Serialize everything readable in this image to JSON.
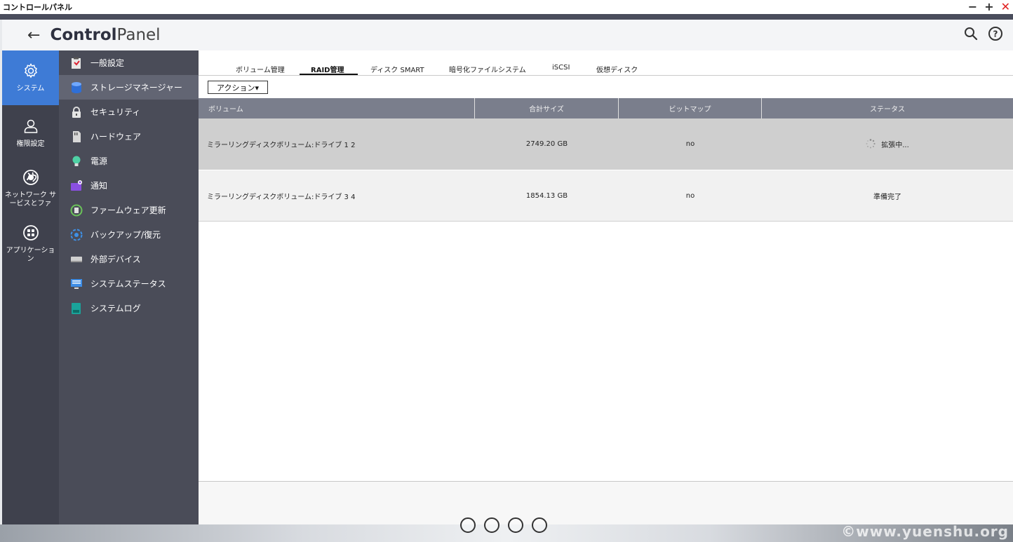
{
  "window": {
    "title": "コントロールパネル",
    "minimize": "−",
    "maximize": "+",
    "close": "✕"
  },
  "header": {
    "back": "←",
    "brand_bold": "Control",
    "brand_light": "Panel"
  },
  "rail": {
    "items": [
      {
        "label": "システム",
        "icon": "gear-icon",
        "active": true
      },
      {
        "label": "権限設定",
        "icon": "user-icon"
      },
      {
        "label": "ネットワーク サービスとファ",
        "icon": "globe-icon"
      },
      {
        "label": "アプリケーション",
        "icon": "apps-icon"
      }
    ]
  },
  "submenu": {
    "items": [
      {
        "label": "一般設定",
        "icon": "clipboard-icon"
      },
      {
        "label": "ストレージマネージャー",
        "icon": "database-icon",
        "active": true
      },
      {
        "label": "セキュリティ",
        "icon": "lock-icon"
      },
      {
        "label": "ハードウェア",
        "icon": "sd-card-icon"
      },
      {
        "label": "電源",
        "icon": "bulb-icon"
      },
      {
        "label": "通知",
        "icon": "notification-icon"
      },
      {
        "label": "ファームウェア更新",
        "icon": "firmware-icon"
      },
      {
        "label": "バックアップ/復元",
        "icon": "backup-icon"
      },
      {
        "label": "外部デバイス",
        "icon": "external-device-icon"
      },
      {
        "label": "システムステータス",
        "icon": "monitor-icon"
      },
      {
        "label": "システムログ",
        "icon": "log-icon"
      }
    ]
  },
  "tabs": [
    {
      "label": "ボリューム管理"
    },
    {
      "label": "RAID管理",
      "active": true
    },
    {
      "label": "ディスク SMART"
    },
    {
      "label": "暗号化ファイルシステム"
    },
    {
      "label": "iSCSI"
    },
    {
      "label": "仮想ディスク"
    }
  ],
  "toolbar": {
    "action_label": "アクション▾"
  },
  "table": {
    "columns": [
      "ボリューム",
      "合計サイズ",
      "ビットマップ",
      "ステータス"
    ],
    "rows": [
      {
        "volume": "ミラーリングディスクボリューム:ドライブ 1 2",
        "size": "2749.20 GB",
        "bitmap": "no",
        "status": "拡張中..."
      },
      {
        "volume": "ミラーリングディスクボリューム:ドライブ 3 4",
        "size": "1854.13 GB",
        "bitmap": "no",
        "status": "準備完了"
      }
    ]
  },
  "watermark": "©www.yuenshu.org",
  "colors": {
    "rail_bg": "#3f414d",
    "rail_active": "#3e7bd6",
    "submenu_bg": "#4a4c58",
    "submenu_active": "#626573",
    "table_header": "#7a7e8c",
    "close_red": "#e02020"
  }
}
